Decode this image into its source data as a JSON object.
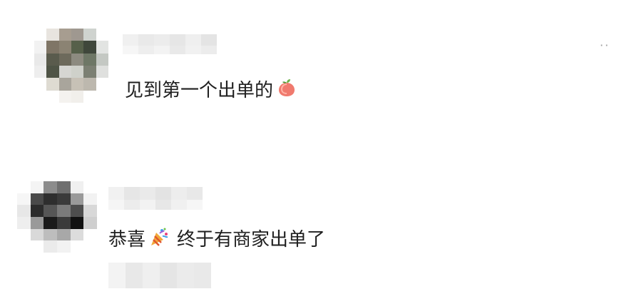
{
  "comments": [
    {
      "text": "见到第一个出单的",
      "emoji_icon": "peach-icon"
    },
    {
      "prefix": "恭喜",
      "emoji_icon": "party-popper-icon",
      "suffix": "终于有商家出单了"
    }
  ],
  "more_label": "··"
}
